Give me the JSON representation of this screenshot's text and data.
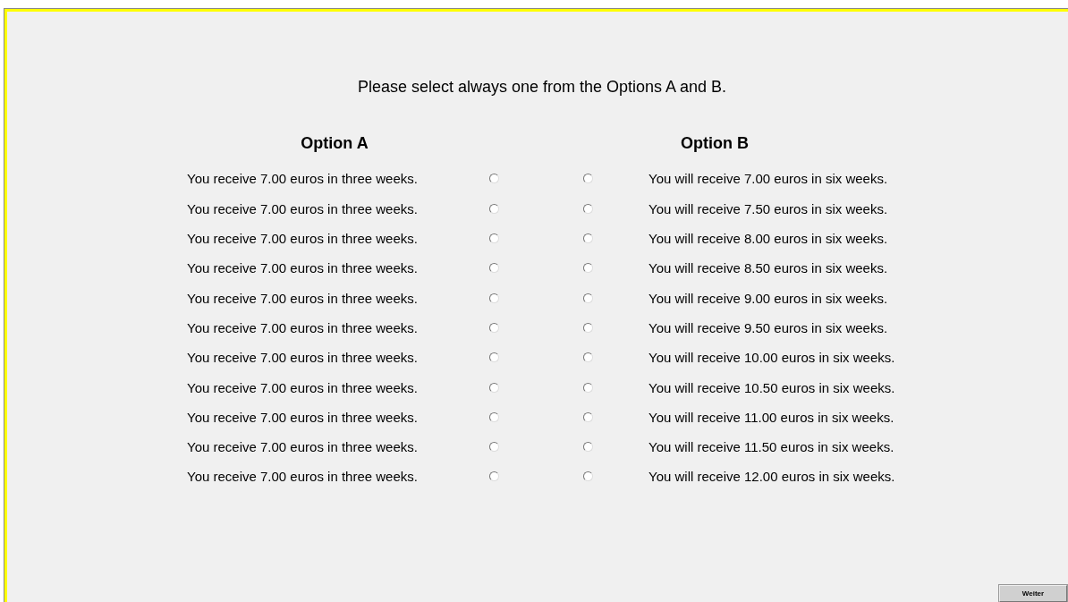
{
  "instruction": "Please select always one from the Options A and B.",
  "headers": [
    "Option A",
    "Option B"
  ],
  "rows": [
    {
      "option_a": {
        "label": "You receive 7.00 euros in three weeks.",
        "selected": false
      },
      "option_b": {
        "label": "You will receive 7.00 euros in six weeks.",
        "selected": false
      }
    },
    {
      "option_a": {
        "label": "You receive 7.00 euros in three weeks.",
        "selected": false
      },
      "option_b": {
        "label": "You will receive 7.50 euros in six weeks.",
        "selected": false
      }
    },
    {
      "option_a": {
        "label": "You receive 7.00 euros in three weeks.",
        "selected": false
      },
      "option_b": {
        "label": "You will receive 8.00 euros in six weeks.",
        "selected": false
      }
    },
    {
      "option_a": {
        "label": "You receive 7.00 euros in three weeks.",
        "selected": false
      },
      "option_b": {
        "label": "You will receive 8.50 euros in six weeks.",
        "selected": false
      }
    },
    {
      "option_a": {
        "label": "You receive 7.00 euros in three weeks.",
        "selected": false
      },
      "option_b": {
        "label": "You will receive 9.00 euros in six weeks.",
        "selected": false
      }
    },
    {
      "option_a": {
        "label": "You receive 7.00 euros in three weeks.",
        "selected": false
      },
      "option_b": {
        "label": "You will receive 9.50 euros in six weeks.",
        "selected": false
      }
    },
    {
      "option_a": {
        "label": "You receive 7.00 euros in three weeks.",
        "selected": false
      },
      "option_b": {
        "label": "You will receive 10.00 euros in six weeks.",
        "selected": false
      }
    },
    {
      "option_a": {
        "label": "You receive 7.00 euros in three weeks.",
        "selected": false
      },
      "option_b": {
        "label": "You will receive 10.50 euros in six weeks.",
        "selected": false
      }
    },
    {
      "option_a": {
        "label": "You receive 7.00 euros in three weeks.",
        "selected": false
      },
      "option_b": {
        "label": "You will receive 11.00 euros in six weeks.",
        "selected": false
      }
    },
    {
      "option_a": {
        "label": "You receive 7.00 euros in three weeks.",
        "selected": false
      },
      "option_b": {
        "label": "You will receive 11.50 euros in six weeks.",
        "selected": false
      }
    },
    {
      "option_a": {
        "label": "You receive 7.00 euros in three weeks.",
        "selected": false
      },
      "option_b": {
        "label": "You will receive 12.00 euros in six weeks.",
        "selected": false
      }
    }
  ],
  "button": "Weiter"
}
